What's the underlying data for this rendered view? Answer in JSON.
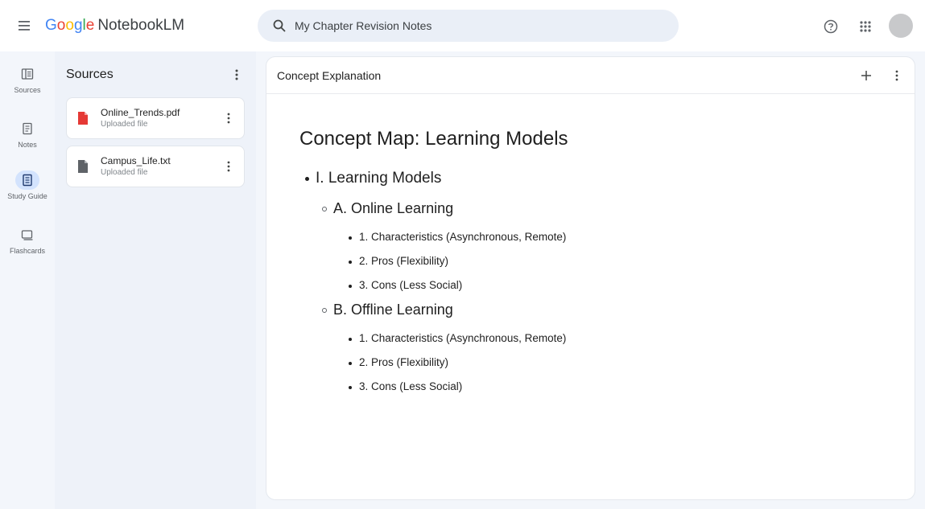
{
  "header": {
    "logo_google": "Google",
    "logo_product": "NotebookLM",
    "search_value": "My Chapter Revision Notes"
  },
  "rail": {
    "items": [
      {
        "label": "Sources",
        "icon": "sources-icon",
        "active": false
      },
      {
        "label": "Notes",
        "icon": "notes-icon",
        "active": false
      },
      {
        "label": "Study Guide",
        "icon": "study-guide-icon",
        "active": true
      },
      {
        "label": "Flashcards",
        "icon": "flashcards-icon",
        "active": false
      }
    ]
  },
  "sources": {
    "title": "Sources",
    "items": [
      {
        "name": "Online_Trends.pdf",
        "subtitle": "Uploaded file",
        "icon": "pdf-file-icon",
        "icon_color": "#e53935"
      },
      {
        "name": "Campus_Life.txt",
        "subtitle": "Uploaded file",
        "icon": "text-file-icon",
        "icon_color": "#5f6368"
      }
    ]
  },
  "main": {
    "title": "Concept Explanation",
    "doc_title": "Concept Map: Learning Models",
    "outline": {
      "heading": "I. Learning Models",
      "sections": [
        {
          "heading": "A. Online Learning",
          "items": [
            "1. Characteristics (Asynchronous, Remote)",
            "2. Pros (Flexibility)",
            "3. Cons (Less Social)"
          ]
        },
        {
          "heading": "B. Offline Learning",
          "items": [
            "1. Characteristics (Asynchronous, Remote)",
            "2. Pros (Flexibility)",
            "3. Cons (Less Social)"
          ]
        }
      ]
    }
  },
  "colors": {
    "background": "#f3f6fb",
    "active_rail": "#d3e3fd",
    "pdf_red": "#e53935"
  }
}
